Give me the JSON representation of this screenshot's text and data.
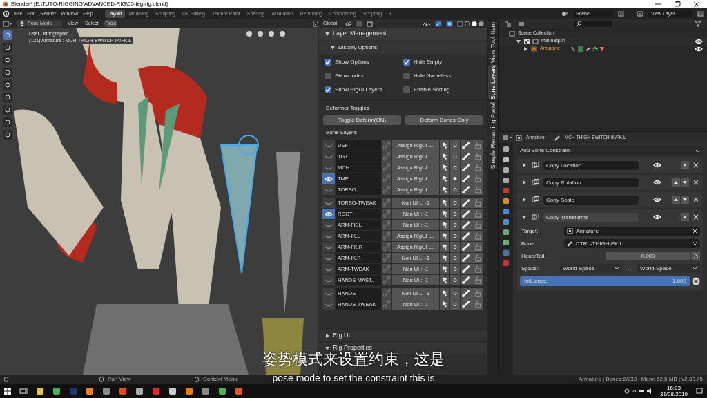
{
  "title_bar": {
    "title": "Blender* [E:\\TUTO-RIGGING\\ADVANCED-RIG\\05-leg-rig.blend]"
  },
  "menu": [
    "File",
    "Edit",
    "Render",
    "Window",
    "Help"
  ],
  "workspaces": [
    {
      "label": "Layout",
      "selected": true
    },
    {
      "label": "Modeling",
      "selected": false
    },
    {
      "label": "Sculpting",
      "selected": false
    },
    {
      "label": "UV Editing",
      "selected": false
    },
    {
      "label": "Texture Paint",
      "selected": false
    },
    {
      "label": "Shading",
      "selected": false
    },
    {
      "label": "Animation",
      "selected": false
    },
    {
      "label": "Rendering",
      "selected": false
    },
    {
      "label": "Compositing",
      "selected": false
    },
    {
      "label": "Scripting",
      "selected": false
    }
  ],
  "add_workspace": "+",
  "scene": "Scene",
  "view_layer": "View Layer",
  "viewport": {
    "mode": "Pose Mode",
    "menus": [
      {
        "label": "View",
        "selected": false
      },
      {
        "label": "Select",
        "selected": false
      },
      {
        "label": "Pose",
        "selected": true
      }
    ],
    "orientation": "Global",
    "view_name": "User Orthographic",
    "object_info": "(121) Armature : MCH-THIGH-SWITCH-IK/FK.L"
  },
  "n_panel": {
    "title": "Layer Management",
    "expanded": true,
    "display_options": {
      "title": "Display Options",
      "expanded": true,
      "options": [
        {
          "label": "Show Options",
          "checked": true
        },
        {
          "label": "Hide Empty",
          "checked": true
        },
        {
          "label": "Show Index",
          "checked": false
        },
        {
          "label": "Hide Nameless",
          "checked": false
        },
        {
          "label": "Show RigUI Layers",
          "checked": true
        },
        {
          "label": "Enable Sorting",
          "checked": false
        }
      ]
    },
    "deformer_title": "Deformer Toggles",
    "deformer_buttons": [
      "Toggle Deform(ON)",
      "Deform Bones Only"
    ],
    "bone_layers_title": "Bone Layers",
    "groups": [
      [
        {
          "name": "DEF",
          "visible": false,
          "assign": "Assign RigUI L..",
          "active": false
        },
        {
          "name": "TGT",
          "visible": false,
          "assign": "Assign RigUI L..",
          "active": false
        },
        {
          "name": "MCH",
          "visible": false,
          "assign": "Assign RigUI L..",
          "active": false
        },
        {
          "name": "TMP",
          "visible": true,
          "assign": "Assign RigUI L..",
          "active": true
        },
        {
          "name": "TORSO",
          "visible": false,
          "assign": "Assign RigUI L..",
          "active": false
        }
      ],
      [
        {
          "name": "TORSO-TWEAK",
          "visible": false,
          "assign": "Non UI L: -1",
          "active": false
        },
        {
          "name": "ROOT",
          "visible": true,
          "assign": "Non UI : -1",
          "active": false
        },
        {
          "name": "ARM-FK.L",
          "visible": false,
          "assign": "Non UI : -1",
          "active": false
        },
        {
          "name": "ARM-IK.L",
          "visible": false,
          "assign": "Assign RigUI L..",
          "active": false
        },
        {
          "name": "ARM-FK.R",
          "visible": false,
          "assign": "Assign RigUI L..",
          "active": false
        },
        {
          "name": "ARM-IK.R",
          "visible": false,
          "assign": "Non UI L: -1",
          "active": false
        },
        {
          "name": "ARM-TWEAK",
          "visible": false,
          "assign": "Non UI : -1",
          "active": false
        },
        {
          "name": "HANDS-MAST..",
          "visible": false,
          "assign": "Non UI : -1",
          "active": false
        }
      ],
      [
        {
          "name": "HANDS",
          "visible": false,
          "assign": "Non UI L: -1",
          "active": false
        },
        {
          "name": "HANDS-TWEAK",
          "visible": false,
          "assign": "Non UI : -1",
          "active": false
        }
      ]
    ],
    "sub_panels": [
      {
        "title": "Rig UI",
        "expanded": false
      },
      {
        "title": "Rig Properties",
        "expanded": true
      }
    ]
  },
  "side_tabs": [
    {
      "label": "Item",
      "selected": false
    },
    {
      "label": "Tool",
      "selected": false
    },
    {
      "label": "View",
      "selected": false
    },
    {
      "label": "Bone Layers",
      "selected": true
    },
    {
      "label": "Simple Renaming Panel",
      "selected": false
    }
  ],
  "outliner": {
    "root": "Scene Collection",
    "items": [
      {
        "name": "mannequin",
        "checked": true,
        "expanded": true,
        "children": [
          {
            "name": "Armature",
            "expanded": false
          }
        ]
      }
    ]
  },
  "properties": {
    "breadcrumb": [
      "Armature",
      "MCH-THIGH-SWITCH-IK/FK.L"
    ],
    "add_label": "Add Bone Constraint",
    "constraints": [
      {
        "name": "Copy Location",
        "expanded": false,
        "move_up": false,
        "move_down": true
      },
      {
        "name": "Copy Rotation",
        "expanded": false,
        "move_up": true,
        "move_down": true
      },
      {
        "name": "Copy Scale",
        "expanded": false,
        "move_up": true,
        "move_down": true
      },
      {
        "name": "Copy Transforms",
        "expanded": true,
        "move_up": true,
        "move_down": false
      }
    ],
    "target_label": "Target:",
    "target": "Armature",
    "bone_label": "Bone:",
    "bone": "CTRL-THIGH-FK.L",
    "head_tail_label": "Head/Tail:",
    "head_tail": "0.000",
    "space_label": "Space:",
    "space_from": "World Space",
    "space_arrow": "↔",
    "space_to": "World Space",
    "influence_label": "Influence:",
    "influence": "1.000",
    "level": 1
  },
  "status_bar": {
    "left": [
      "Pan View",
      "Context Menu"
    ],
    "right": "Armature | Bones:2/233 | Mem: 62.5 MB | v2.80.75"
  },
  "taskbar": {
    "time": "16:23",
    "date": "31/08/2019"
  },
  "subtitles": {
    "zh": "姿势模式来设置约束，这是",
    "en": "pose mode to set the constraint this is"
  }
}
